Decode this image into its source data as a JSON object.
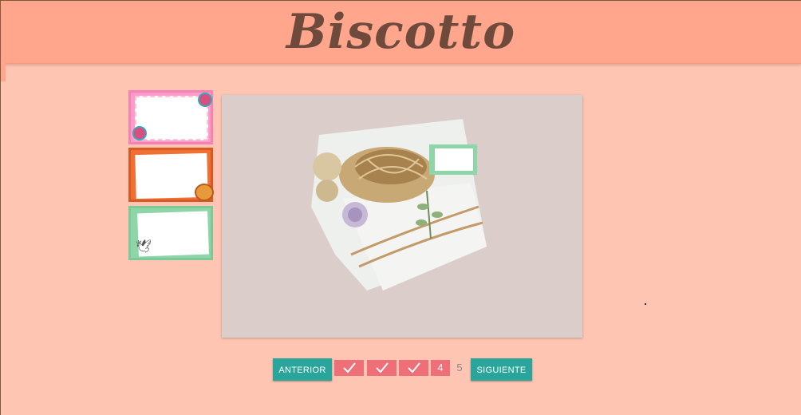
{
  "header": {
    "brand": "Biscotto"
  },
  "thumbnails": [
    {
      "name": "pink-flower-tag"
    },
    {
      "name": "orange-fox-tag"
    },
    {
      "name": "green-bird-tag"
    }
  ],
  "pager": {
    "prev_label": "ANTERIOR",
    "next_label": "SIGUIENTE",
    "steps": [
      {
        "state": "done",
        "icon": "check-icon"
      },
      {
        "state": "done",
        "icon": "check-icon"
      },
      {
        "state": "done",
        "icon": "check-icon"
      },
      {
        "label": "4",
        "state": "current"
      },
      {
        "label": "5",
        "state": "pending"
      }
    ]
  },
  "colors": {
    "background": "#fec6b2",
    "header": "#ffa68c",
    "brand_text": "#6e4a3c",
    "button": "#2aa59c",
    "step_done": "#ef6f78"
  }
}
